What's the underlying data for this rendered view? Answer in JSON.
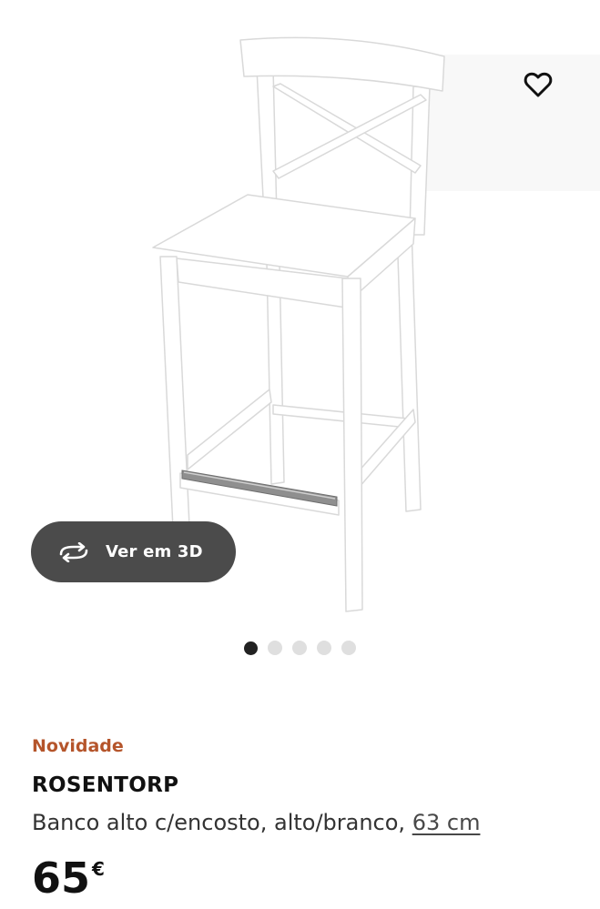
{
  "gallery": {
    "image_alt": "ROSENTORP",
    "wishlist_icon": "heart-icon",
    "view_3d": {
      "icon": "rotate-3d-icon",
      "label": "Ver em 3D"
    },
    "dots": {
      "total": 5,
      "active_index": 0
    }
  },
  "product": {
    "badge": "Novidade",
    "name": "ROSENTORP",
    "description": "Banco alto c/encosto, alto/branco, ",
    "size_link": "63 cm",
    "price": {
      "amount": "65",
      "currency": "€"
    }
  },
  "colors": {
    "badge": "#b5552b",
    "button_bg": "#4b4b4b",
    "dot_active": "#222222",
    "dot_inactive": "#dfdfdf"
  }
}
